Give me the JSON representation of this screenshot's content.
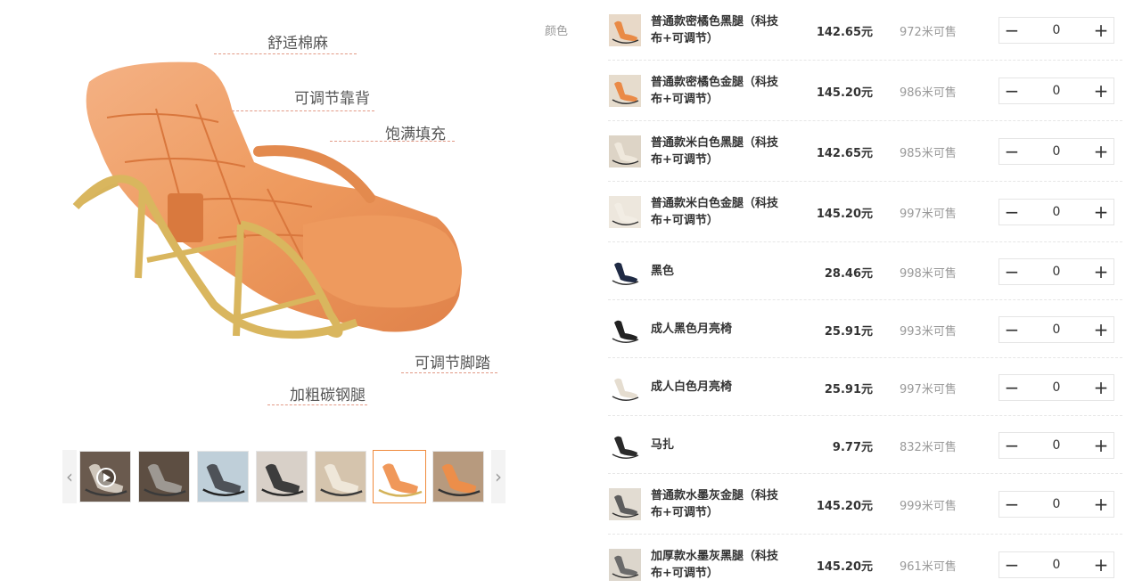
{
  "main_image": {
    "callouts": {
      "cotton": "舒适棉麻",
      "backrest": "可调节靠背",
      "filling": "饱满填充",
      "footrest": "可调节脚踏",
      "legs": "加粗碳钢腿"
    }
  },
  "thumbnails": [
    {
      "name": "video",
      "bg": "#6a5a4e",
      "seat": "#cfc6bb",
      "frame": "#3a3a3a"
    },
    {
      "name": "grey-room",
      "bg": "#5d4e42",
      "seat": "#9d9892",
      "frame": "#3a3a3a"
    },
    {
      "name": "outdoor",
      "bg": "#bfcfd9",
      "seat": "#4e5258",
      "frame": "#222222"
    },
    {
      "name": "dark",
      "bg": "#d8d0c8",
      "seat": "#3d3d3d",
      "frame": "#2a2a2a"
    },
    {
      "name": "cream",
      "bg": "#d5c4ad",
      "seat": "#efe7d9",
      "frame": "#3a3a3a"
    },
    {
      "name": "orange-white",
      "bg": "#ffffff",
      "seat": "#f0985a",
      "frame": "#d4b35a"
    },
    {
      "name": "orange-room",
      "bg": "#b79a7e",
      "seat": "#ec8e4a",
      "frame": "#333333"
    }
  ],
  "color_label": "颜色",
  "skus": [
    {
      "name_l1": "普通款密橘色黑腿（科技",
      "name_l2": "布+可调节）",
      "price": "142.65元",
      "stock": "972米可售",
      "qty": "0",
      "thumb_bg": "#e8d9c8",
      "thumb_fg": "#e98a45"
    },
    {
      "name_l1": "普通款密橘色金腿（科技",
      "name_l2": "布+可调节）",
      "price": "145.20元",
      "stock": "986米可售",
      "qty": "0",
      "thumb_bg": "#e6dccd",
      "thumb_fg": "#ea8a47"
    },
    {
      "name_l1": "普通款米白色黑腿（科技",
      "name_l2": "布+可调节）",
      "price": "142.65元",
      "stock": "985米可售",
      "qty": "0",
      "thumb_bg": "#ddd4c6",
      "thumb_fg": "#efe8dc"
    },
    {
      "name_l1": "普通款米白色金腿（科技",
      "name_l2": "布+可调节）",
      "price": "145.20元",
      "stock": "997米可售",
      "qty": "0",
      "thumb_bg": "#ede7dd",
      "thumb_fg": "#f2ede4"
    },
    {
      "name_l1": "黑色",
      "name_l2": "",
      "price": "28.46元",
      "stock": "998米可售",
      "qty": "0",
      "thumb_bg": "#ffffff",
      "thumb_fg": "#1f2a44"
    },
    {
      "name_l1": "成人黑色月亮椅",
      "name_l2": "",
      "price": "25.91元",
      "stock": "993米可售",
      "qty": "0",
      "thumb_bg": "#ffffff",
      "thumb_fg": "#222222"
    },
    {
      "name_l1": "成人白色月亮椅",
      "name_l2": "",
      "price": "25.91元",
      "stock": "997米可售",
      "qty": "0",
      "thumb_bg": "#ffffff",
      "thumb_fg": "#e5ddd0"
    },
    {
      "name_l1": "马扎",
      "name_l2": "",
      "price": "9.77元",
      "stock": "832米可售",
      "qty": "0",
      "thumb_bg": "#ffffff",
      "thumb_fg": "#2a2a2a"
    },
    {
      "name_l1": "普通款水墨灰金腿（科技",
      "name_l2": "布+可调节）",
      "price": "145.20元",
      "stock": "999米可售",
      "qty": "0",
      "thumb_bg": "#e2dcd2",
      "thumb_fg": "#5d5d5d"
    },
    {
      "name_l1": "加厚款水墨灰黑腿（科技",
      "name_l2": "布+可调节）",
      "price": "145.20元",
      "stock": "961米可售",
      "qty": "0",
      "thumb_bg": "#dcd6cc",
      "thumb_fg": "#6a6a6a"
    }
  ],
  "stepper": {
    "minus": "−",
    "plus": "+"
  },
  "arrows": {
    "prev": "‹",
    "next": "›"
  }
}
